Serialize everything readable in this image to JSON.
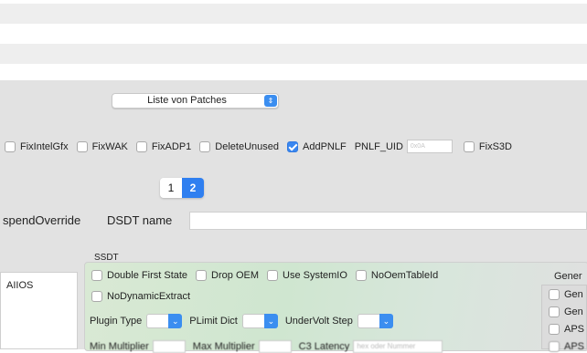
{
  "patches_popup": {
    "label": "Liste von Patches"
  },
  "fixes": [
    {
      "label": "FixIntelGfx",
      "checked": false
    },
    {
      "label": "FixWAK",
      "checked": false
    },
    {
      "label": "FixADP1",
      "checked": false
    },
    {
      "label": "DeleteUnused",
      "checked": false
    },
    {
      "label": "AddPNLF",
      "checked": true
    }
  ],
  "pnlf_uid": {
    "label": "PNLF_UID",
    "placeholder": "0x0A"
  },
  "fix_s3d": {
    "label": "FixS3D",
    "checked": false
  },
  "pager": {
    "page1": "1",
    "page2": "2"
  },
  "suspend_override": {
    "label": "spendOverride"
  },
  "dsdt_name": {
    "label": "DSDT name",
    "value": ""
  },
  "aiios_label": "AIIOS",
  "ssdt": {
    "title": "SSDT",
    "options": [
      {
        "label": "Double First State",
        "checked": false
      },
      {
        "label": "Drop OEM",
        "checked": false
      },
      {
        "label": "Use SystemIO",
        "checked": false
      },
      {
        "label": "NoOemTableId",
        "checked": false
      }
    ],
    "no_dynamic_extract": {
      "label": "NoDynamicExtract",
      "checked": false
    },
    "plugin_type": {
      "label": "Plugin Type"
    },
    "plimit_dict": {
      "label": "PLimit Dict"
    },
    "undervolt_step": {
      "label": "UnderVolt Step"
    },
    "min_multiplier": {
      "label": "Min Multiplier"
    },
    "max_multiplier": {
      "label": "Max Multiplier"
    },
    "c3_latency": {
      "label": "C3 Latency",
      "placeholder": "hex oder Nummer"
    }
  },
  "generate": {
    "title": "Gener",
    "items": [
      {
        "label": "Gen",
        "checked": false
      },
      {
        "label": "Gen",
        "checked": false
      },
      {
        "label": "APS",
        "checked": false
      },
      {
        "label": "APS",
        "checked": false
      }
    ]
  }
}
